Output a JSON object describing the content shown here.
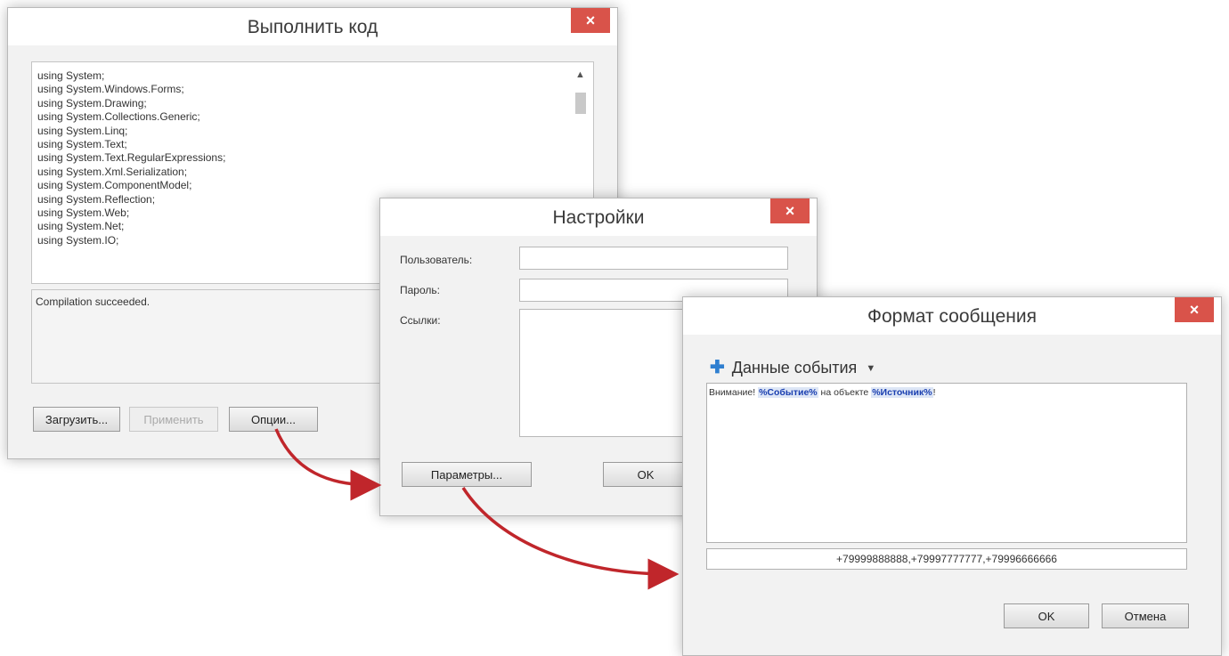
{
  "run_code_window": {
    "title": "Выполнить код",
    "close_label": "×",
    "code_lines": [
      "using System;",
      "using System.Windows.Forms;",
      "using System.Drawing;",
      "using System.Collections.Generic;",
      "using System.Linq;",
      "using System.Text;",
      "using System.Text.RegularExpressions;",
      "using System.Xml.Serialization;",
      "using System.ComponentModel;",
      "using System.Reflection;",
      "using System.Web;",
      "using System.Net;",
      "using System.IO;"
    ],
    "output_text": "Compilation succeeded.",
    "load_button": "Загрузить...",
    "apply_button": "Применить",
    "options_button": "Опции..."
  },
  "settings_window": {
    "title": "Настройки",
    "close_label": "×",
    "user_label": "Пользователь:",
    "user_value": "",
    "password_label": "Пароль:",
    "password_value": "",
    "links_label": "Ссылки:",
    "links_value": "",
    "parameters_button": "Параметры...",
    "ok_button": "OK"
  },
  "message_format_window": {
    "title": "Формат сообщения",
    "close_label": "×",
    "event_data_menu": "Данные события",
    "message_prefix": "Внимание! ",
    "token_event": "%Событие%",
    "message_middle": " на объекте ",
    "token_source": "%Источник%",
    "message_suffix": "!",
    "phones_value": "+79999888888,+79997777777,+79996666666",
    "ok_button": "OK",
    "cancel_button": "Отмена"
  },
  "colors": {
    "close_button": "#d9534a",
    "arrow": "#c0262b",
    "token_text": "#1a3fb0"
  },
  "icons": [
    "close-icon",
    "plus-icon",
    "chevron-down-icon",
    "scroll-up-icon",
    "flow-arrow"
  ]
}
